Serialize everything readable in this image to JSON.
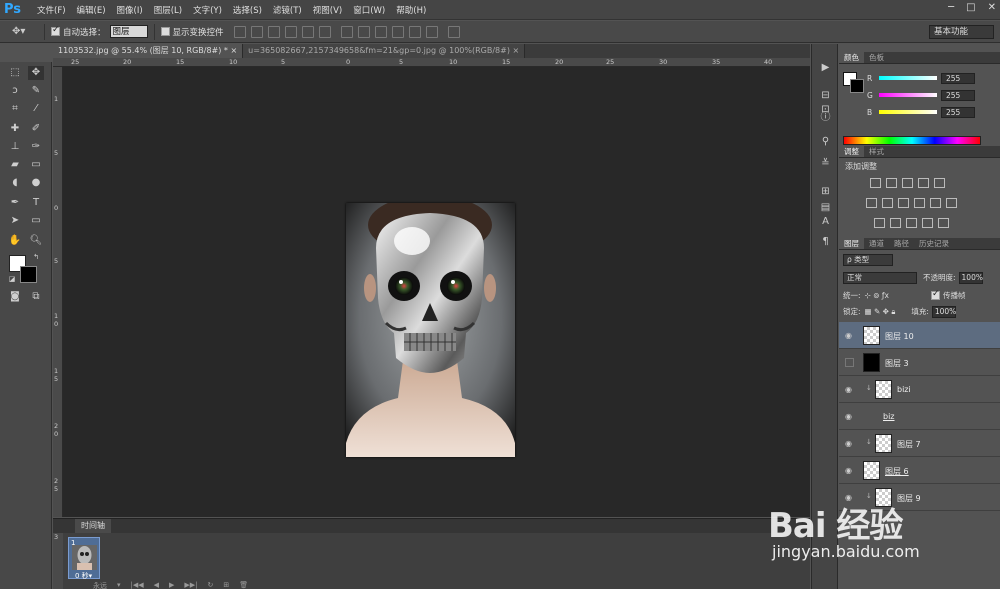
{
  "app": {
    "logo": "Ps",
    "menu": [
      "文件(F)",
      "编辑(E)",
      "图像(I)",
      "图层(L)",
      "文字(Y)",
      "选择(S)",
      "滤镜(T)",
      "视图(V)",
      "窗口(W)",
      "帮助(H)"
    ],
    "window_controls": [
      "─",
      "□",
      "✕"
    ]
  },
  "options_bar": {
    "auto_select_label": "自动选择：",
    "auto_select_checked": true,
    "auto_select_target": "图层",
    "show_transform_label": "显示变换控件",
    "show_transform_checked": false,
    "workspace": "基本功能"
  },
  "tabs": [
    {
      "label": "1103532.jpg @ 55.4% (图层 10, RGB/8#) *",
      "close": "×",
      "active": true
    },
    {
      "label": "u=365082667,2157349658&fm=21&gp=0.jpg @ 100%(RGB/8#)",
      "close": "×",
      "active": false
    }
  ],
  "rulers": {
    "top": [
      "25",
      "20",
      "15",
      "10",
      "5",
      "0",
      "5",
      "10",
      "15",
      "20",
      "25",
      "30",
      "35",
      "40"
    ],
    "left": [
      "1",
      "5",
      "0",
      "5",
      "1 0",
      "1 5",
      "2 0",
      "2 5"
    ]
  },
  "timeline": {
    "tab": "时间轴",
    "frame_number": "1",
    "frame_time": "0 秒▾",
    "left_number": "3",
    "loop": "永远",
    "controls": [
      "▾",
      "|◀◀",
      "◀",
      "▶",
      "▶▶|",
      "↻",
      "⊞",
      "🗑"
    ]
  },
  "color_panel": {
    "tabs": [
      "颜色",
      "色板"
    ],
    "channels": [
      {
        "label": "R",
        "value": "255"
      },
      {
        "label": "G",
        "value": "255"
      },
      {
        "label": "B",
        "value": "255"
      }
    ]
  },
  "adjustments_panel": {
    "tabs": [
      "调整",
      "样式"
    ],
    "title": "添加调整"
  },
  "layers_panel": {
    "tabs": [
      "图层",
      "通道",
      "路径",
      "历史记录"
    ],
    "filter_kind": "ρ 类型",
    "blend_mode": "正常",
    "opacity_label": "不透明度:",
    "opacity": "100%",
    "unify_label": "统一:",
    "propagate_label": "传播帧",
    "lock_label": "锁定:",
    "fill_label": "填充:",
    "fill": "100%",
    "layers": [
      {
        "name": "图层 10",
        "visible": true,
        "selected": true,
        "thumb": "transparent",
        "clipped": false,
        "underline": false
      },
      {
        "name": "图层 3",
        "visible": false,
        "selected": false,
        "thumb": "black",
        "clipped": false,
        "underline": false
      },
      {
        "name": "bizi",
        "visible": true,
        "selected": false,
        "thumb": "transparent",
        "clipped": true,
        "underline": false
      },
      {
        "name": "biz",
        "visible": true,
        "selected": false,
        "thumb": "none",
        "clipped": false,
        "underline": true
      },
      {
        "name": "图层 7",
        "visible": true,
        "selected": false,
        "thumb": "transparent",
        "clipped": true,
        "underline": false
      },
      {
        "name": "图层 6",
        "visible": true,
        "selected": false,
        "thumb": "transparent",
        "clipped": false,
        "underline": true
      },
      {
        "name": "图层 9",
        "visible": true,
        "selected": false,
        "thumb": "transparent",
        "clipped": true,
        "underline": false
      }
    ]
  },
  "watermark": {
    "main": "Bai 经验",
    "sub": "jingyan.baidu.com"
  }
}
